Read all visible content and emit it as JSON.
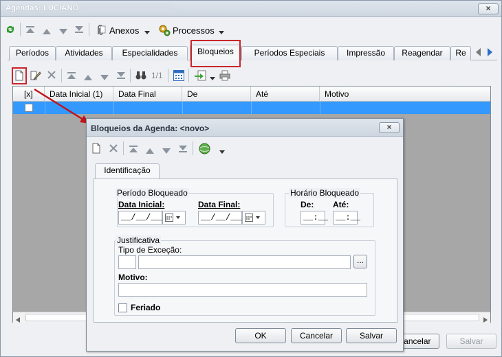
{
  "window": {
    "title": "Agendas: LUCIANO",
    "close_label": "×"
  },
  "toolbar": {
    "anexos_label": "Anexos",
    "processos_label": "Processos"
  },
  "tabs": [
    "Períodos",
    "Atividades",
    "Especialidades",
    "Bloqueios",
    "Períodos Especiais",
    "Impressão",
    "Reagendar",
    "Re"
  ],
  "active_tab": "Bloqueios",
  "subtoolbar": {
    "page_counter": "1/1"
  },
  "grid": {
    "columns": [
      "[x]",
      "Data Inicial (1)",
      "Data Final",
      "De",
      "Até",
      "Motivo"
    ]
  },
  "bottom_buttons": {
    "cancel_label": "Cancelar",
    "save_label": "Salvar"
  },
  "dialog": {
    "title": "Bloqueios da Agenda: <novo>",
    "close_label": "×",
    "tab_label": "Identificação",
    "periodo": {
      "legend": "Período Bloqueado",
      "data_inicial_label": "Data Inicial:",
      "data_inicial_value": "__/__/____",
      "data_final_label": "Data Final:",
      "data_final_value": "__/__/____"
    },
    "horario": {
      "legend": "Horário Bloqueado",
      "de_label": "De:",
      "de_value": "__:__",
      "ate_label": "Até:",
      "ate_value": "__:__"
    },
    "justificativa": {
      "legend": "Justificativa",
      "tipo_label": "Tipo de Exceção:",
      "browse_label": "...",
      "motivo_label": "Motivo:",
      "feriado_label": "Feriado"
    },
    "buttons": {
      "ok_label": "OK",
      "cancel_label": "Cancelar",
      "save_label": "Salvar"
    }
  },
  "colors": {
    "selection": "#3399ff",
    "highlight": "#c9252b",
    "arrow": "#c0141b"
  }
}
